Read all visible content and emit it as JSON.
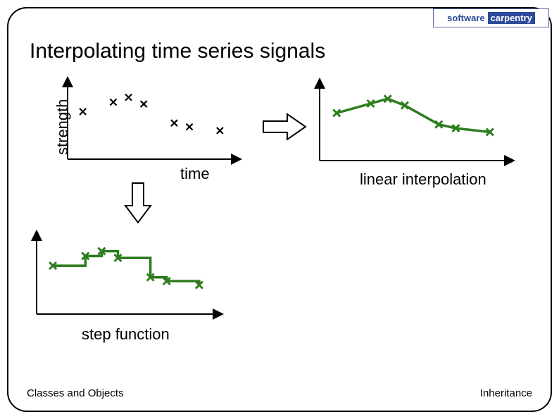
{
  "logo": {
    "word1": "software",
    "word2": "carpentry"
  },
  "title": "Interpolating time series signals",
  "labels": {
    "ylabel": "strength",
    "xlabel": "time",
    "linear": "linear interpolation",
    "step": "step function"
  },
  "footer": {
    "left": "Classes and Objects",
    "right": "Inheritance"
  },
  "chart_data": [
    {
      "name": "scatter-source",
      "type": "scatter",
      "xlabel": "time",
      "ylabel": "strength",
      "points": [
        {
          "x": 1,
          "y": 5.0
        },
        {
          "x": 3,
          "y": 6.0
        },
        {
          "x": 4,
          "y": 6.5
        },
        {
          "x": 5,
          "y": 5.8
        },
        {
          "x": 7,
          "y": 3.8
        },
        {
          "x": 8,
          "y": 3.4
        },
        {
          "x": 10,
          "y": 3.0
        }
      ],
      "xlim": [
        0,
        11
      ],
      "ylim": [
        0,
        8
      ]
    },
    {
      "name": "linear-interpolation",
      "type": "line",
      "title": "linear interpolation",
      "series": [
        {
          "name": "interp",
          "style": "linear",
          "points": [
            {
              "x": 1,
              "y": 5.0
            },
            {
              "x": 3,
              "y": 6.0
            },
            {
              "x": 4,
              "y": 6.5
            },
            {
              "x": 5,
              "y": 5.8
            },
            {
              "x": 7,
              "y": 3.8
            },
            {
              "x": 8,
              "y": 3.4
            },
            {
              "x": 10,
              "y": 3.0
            }
          ]
        }
      ],
      "xlim": [
        0,
        11
      ],
      "ylim": [
        0,
        8
      ]
    },
    {
      "name": "step-function",
      "type": "line",
      "title": "step function",
      "series": [
        {
          "name": "step",
          "style": "step-post",
          "points": [
            {
              "x": 1,
              "y": 5.0
            },
            {
              "x": 3,
              "y": 6.0
            },
            {
              "x": 4,
              "y": 6.5
            },
            {
              "x": 5,
              "y": 5.8
            },
            {
              "x": 7,
              "y": 3.8
            },
            {
              "x": 8,
              "y": 3.4
            },
            {
              "x": 10,
              "y": 3.0
            }
          ]
        }
      ],
      "xlim": [
        0,
        11
      ],
      "ylim": [
        0,
        8
      ]
    }
  ]
}
